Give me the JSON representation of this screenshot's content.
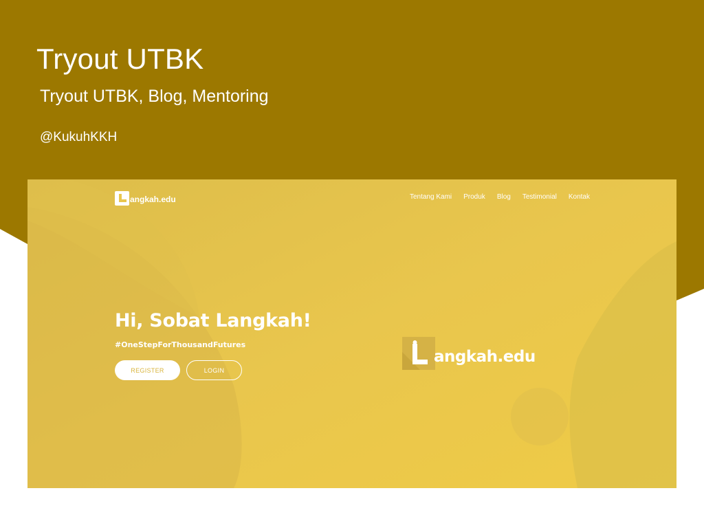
{
  "header": {
    "title": "Tryout UTBK",
    "subtitle": "Tryout UTBK, Blog, Mentoring",
    "handle": "@KukuhKKH"
  },
  "navbar": {
    "logo_text": "angkah.edu",
    "menu": [
      "Tentang Kami",
      "Produk",
      "Blog",
      "Testimonial",
      "Kontak"
    ]
  },
  "hero": {
    "title": "Hi, Sobat Langkah!",
    "tagline": "#OneStepForThousandFutures",
    "register_label": "REGISTER",
    "login_label": "LOGIN",
    "logo_text": "angkah.edu"
  },
  "colors": {
    "header_band": "#9c7800",
    "hero_bg": "#e9c64d",
    "accent": "#d9b53e"
  },
  "icons": {
    "nav_logo": "langkah-logo-icon",
    "hero_logo": "langkah-logo-icon"
  }
}
